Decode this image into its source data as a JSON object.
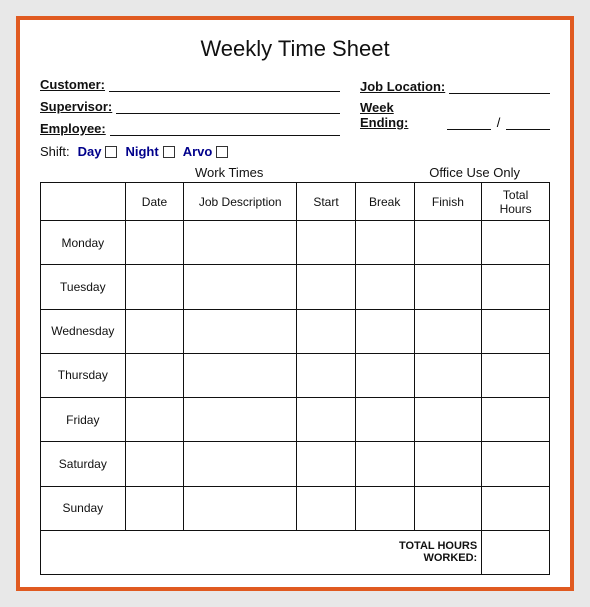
{
  "title": "Weekly Time Sheet",
  "fields": {
    "customer_label": "Customer:",
    "supervisor_label": "Supervisor:",
    "employee_label": "Employee:",
    "job_location_label": "Job Location:",
    "week_ending_label": "Week Ending:"
  },
  "shift": {
    "label": "Shift:",
    "options": [
      "Day",
      "Night",
      "Arvo"
    ]
  },
  "section_labels": {
    "work_times": "Work Times",
    "office_use": "Office Use Only"
  },
  "table": {
    "headers": [
      "",
      "Date",
      "Job Description",
      "Start",
      "Break",
      "Finish",
      "Total\nHours"
    ],
    "days": [
      "Monday",
      "Tuesday",
      "Wednesday",
      "Thursday",
      "Friday",
      "Saturday",
      "Sunday"
    ],
    "total_row_label": "TOTAL HOURS WORKED:"
  }
}
